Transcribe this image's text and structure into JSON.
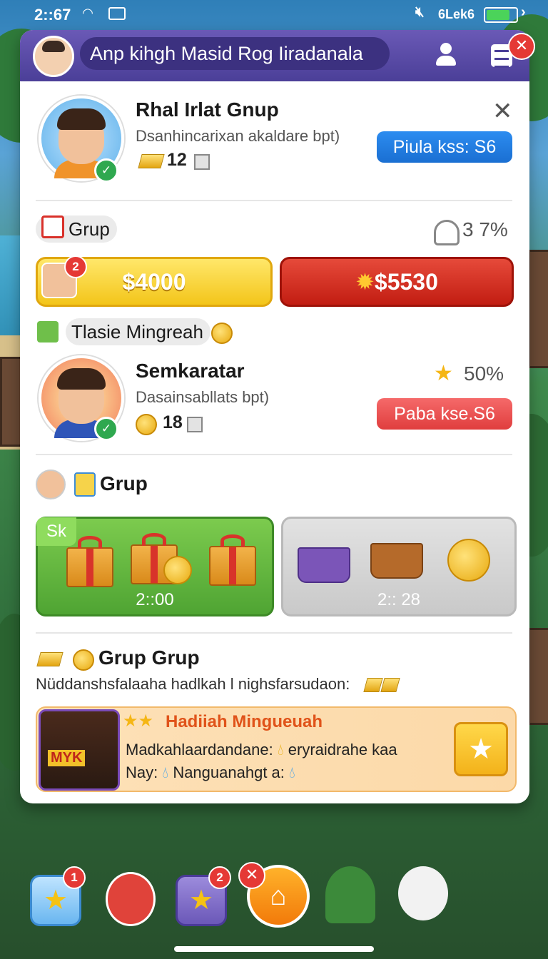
{
  "status_bar": {
    "time": "2::67",
    "network": "6Lek6"
  },
  "header": {
    "title": "Anp kihgh Masid Rog Iiradanala"
  },
  "profile_1": {
    "name": "Rhal Irlat Gnup",
    "subtitle": "Dsanhincarixan akaldare bpt)",
    "count": "12",
    "button_label": "Piula kss: S6"
  },
  "section_group": {
    "tag_label": "Grup",
    "percent": "3 7%",
    "yellow_button": "$4000",
    "yellow_badge": "2",
    "red_button": "$5530"
  },
  "weekly_tag": {
    "label": "Tlasie Mingreah"
  },
  "profile_2": {
    "name": "Semkaratar",
    "subtitle": "Dasainsabllats bpt)",
    "count": "18",
    "percent": "50%",
    "button_label": "Paba kse.S6"
  },
  "rewards": {
    "title": "Grup",
    "card_green": {
      "tag": "Sk",
      "timer": "2::00"
    },
    "card_gray": {
      "timer": "2:: 28"
    }
  },
  "group_group": {
    "title": "Grup Grup",
    "description": "Nüddanshsfalaaha hadlkah l nighsfarsudaon:"
  },
  "promo": {
    "title": "Hadiiah Mingueuah",
    "pic_label": "MYK",
    "line1": "Madkahlaardandane:",
    "line1_tail": "eryraidrahe kaa",
    "line2": "Nay:",
    "line2_tail": "Nanguanahgt a:"
  },
  "dock": {
    "badge_1": "1",
    "badge_2": "2"
  },
  "colors": {
    "accent_purple": "#4b3f98",
    "yellow": "#f7d94c",
    "red": "#d52b1e",
    "green": "#5cb85c",
    "blue": "#1f7ad6"
  }
}
